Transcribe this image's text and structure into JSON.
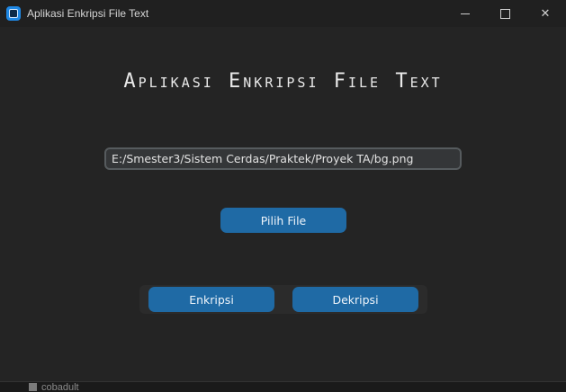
{
  "window": {
    "title": "Aplikasi Enkripsi File Text",
    "app_icon": "app-icon"
  },
  "title_controls": {
    "minimize_icon": "minimize-icon",
    "maximize_icon": "maximize-icon",
    "close_icon": "close-icon",
    "close_glyph": "✕"
  },
  "main": {
    "heading": "Aplikasi Enkripsi File Text",
    "file_path_value": "E:/Smester3/Sistem Cerdas/Praktek/Proyek TA/bg.png",
    "choose_file_label": "Pilih File",
    "encrypt_label": "Enkripsi",
    "decrypt_label": "Dekripsi"
  },
  "background": {
    "partial_text": "cobadult"
  },
  "colors": {
    "accent": "#1f6aa5",
    "window_bg": "#242424",
    "titlebar_bg": "#202020",
    "input_bg": "#343638",
    "input_border": "#565b5e"
  }
}
